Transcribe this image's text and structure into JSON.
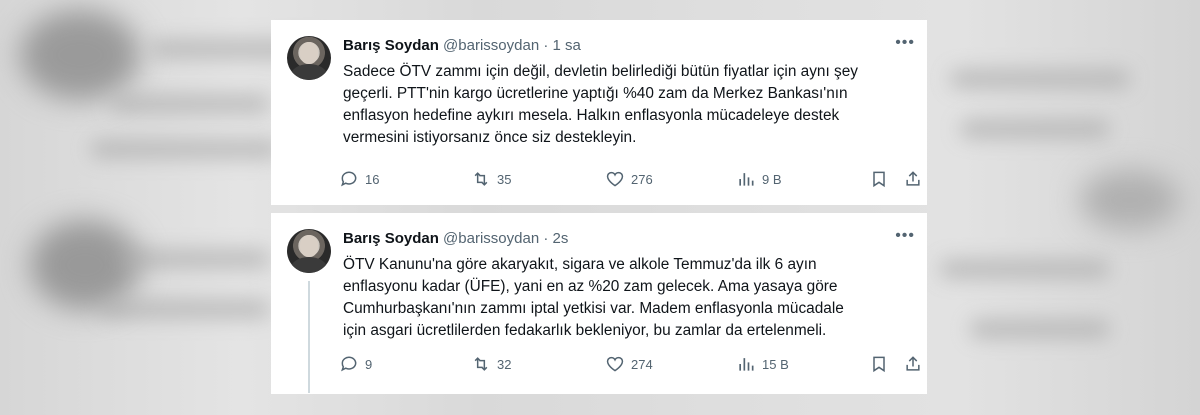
{
  "tweets": [
    {
      "author_name": "Barış Soydan",
      "handle": "@barissoydan",
      "separator": "·",
      "time": "1 sa",
      "more_label": "•••",
      "text_lines": [
        "Sadece ÖTV zammı için değil, devletin belirlediği bütün fiyatlar için aynı şey",
        "geçerli. PTT'nin kargo ücretlerine yaptığı %40 zam da Merkez Bankası'nın",
        "enflasyon hedefine aykırı mesela. Halkın enflasyonla mücadeleye destek",
        "vermesini istiyorsanız önce siz destekleyin."
      ],
      "replies": "16",
      "retweets": "35",
      "likes": "276",
      "views": "9 B"
    },
    {
      "author_name": "Barış Soydan",
      "handle": "@barissoydan",
      "separator": "·",
      "time": "2s",
      "more_label": "•••",
      "text_lines": [
        "ÖTV Kanunu'na göre akaryakıt, sigara ve alkole Temmuz'da ilk 6 ayın",
        "enflasyonu kadar (ÜFE), yani en az %20 zam gelecek. Ama yasaya göre",
        "Cumhurbaşkanı'nın zammı iptal yetkisi var. Madem enflasyonla mücadale",
        "için asgari ücretlilerden fedakarlık bekleniyor, bu zamlar da ertelenmeli."
      ],
      "replies": "9",
      "retweets": "32",
      "likes": "274",
      "views": "15 B"
    }
  ],
  "colors": {
    "text_primary": "#0f1419",
    "text_secondary": "#536471",
    "card_bg": "#ffffff",
    "thread_line": "#cfd9de"
  },
  "icons": [
    "reply-icon",
    "retweet-icon",
    "like-icon",
    "views-icon",
    "bookmark-icon",
    "share-icon"
  ]
}
